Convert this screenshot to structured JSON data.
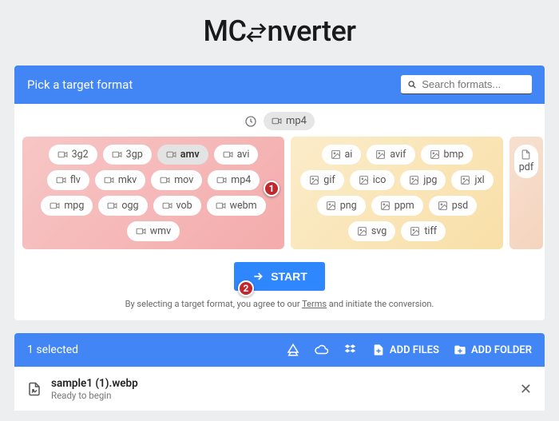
{
  "brand": {
    "pre": "MC",
    "post": "nverter"
  },
  "picker": {
    "title": "Pick a target format",
    "search_placeholder": "Search formats...",
    "recent": "mp4",
    "start_label": "START",
    "terms_pre": "By selecting a target format, you agree to our ",
    "terms_link": "Terms",
    "terms_post": " and initiate the conversion."
  },
  "video_formats": [
    "3g2",
    "3gp",
    "amv",
    "avi",
    "flv",
    "mkv",
    "mov",
    "mp4",
    "mpg",
    "ogg",
    "vob",
    "webm",
    "wmv"
  ],
  "selected_video": "amv",
  "image_formats": [
    "ai",
    "avif",
    "bmp",
    "gif",
    "ico",
    "jpg",
    "jxl",
    "png",
    "ppm",
    "psd",
    "svg",
    "tiff"
  ],
  "doc_formats": [
    "pdf"
  ],
  "toolbar": {
    "selected_label": "1 selected",
    "add_files": "ADD FILES",
    "add_folder": "ADD FOLDER"
  },
  "file": {
    "name": "sample1 (1).webp",
    "status": "Ready to begin"
  },
  "annotations": {
    "one": "1",
    "two": "2"
  }
}
